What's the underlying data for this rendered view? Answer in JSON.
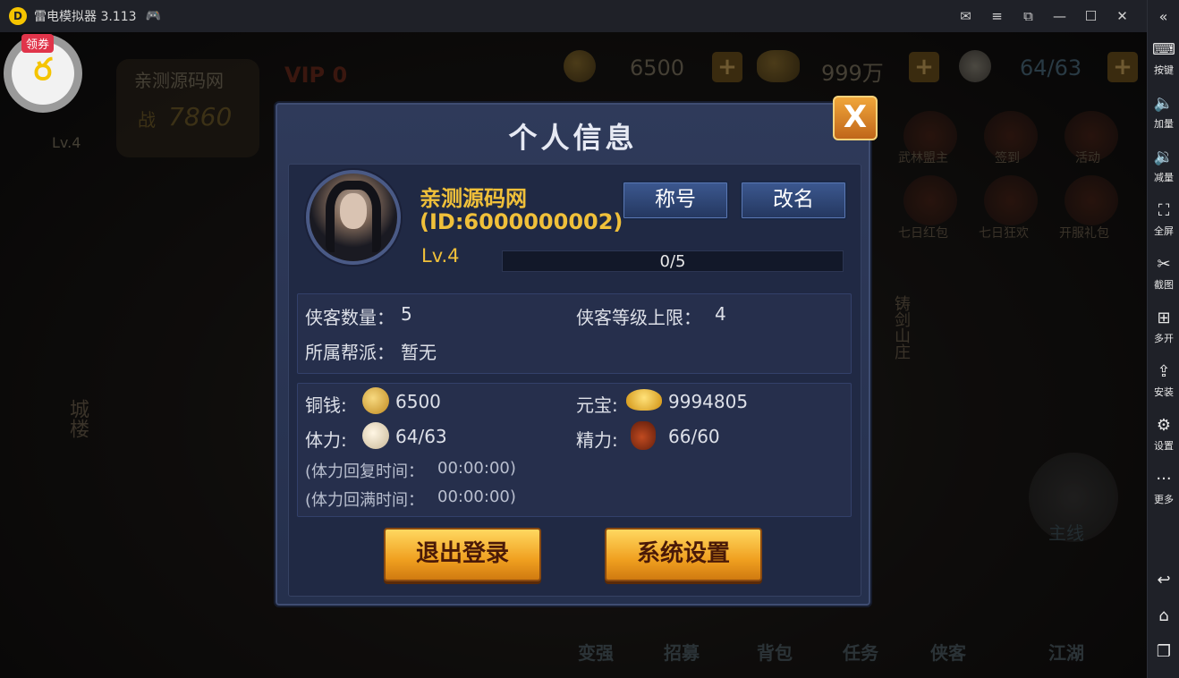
{
  "emulator": {
    "title": "雷电模拟器 3.113",
    "sidebar": [
      {
        "label": "按键",
        "icon": "keyboard-icon"
      },
      {
        "label": "加量",
        "icon": "volume-up-icon"
      },
      {
        "label": "减量",
        "icon": "volume-down-icon"
      },
      {
        "label": "全屏",
        "icon": "fullscreen-icon"
      },
      {
        "label": "截图",
        "icon": "scissors-icon"
      },
      {
        "label": "多开",
        "icon": "multi-instance-icon"
      },
      {
        "label": "安装",
        "icon": "apk-install-icon"
      },
      {
        "label": "设置",
        "icon": "gear-icon"
      },
      {
        "label": "更多",
        "icon": "more-icon"
      }
    ]
  },
  "float_widget": {
    "tag": "领券"
  },
  "hud": {
    "player_name": "亲测源码网",
    "vip": "VIP 0",
    "power_label": "战",
    "power": "7860",
    "level": "Lv.4",
    "copper": "6500",
    "ingot": "999万",
    "stamina": "64/63"
  },
  "background_menu": [
    "武林盟主",
    "签到",
    "活动",
    "七日红包",
    "七日狂欢",
    "开服礼包",
    "铸剑山庄",
    "城楼",
    "主线"
  ],
  "bottom_menu": [
    "变强",
    "招募",
    "背包",
    "任务",
    "侠客",
    "江湖"
  ],
  "dialog": {
    "title": "个人信息",
    "close_label": "X",
    "profile": {
      "name": "亲测源码网",
      "id": "(ID:6000000002)",
      "level": "Lv.4",
      "exp": "0/5",
      "exp_fraction": 0
    },
    "buttons": {
      "title_label": "称号",
      "rename_label": "改名"
    },
    "info": {
      "hero_count_label": "侠客数量：",
      "hero_count": "5",
      "hero_level_cap_label": "侠客等级上限：",
      "hero_level_cap": "4",
      "guild_label": "所属帮派：",
      "guild": "暂无"
    },
    "resources": {
      "copper_label": "铜钱:",
      "copper": "6500",
      "ingot_label": "元宝:",
      "ingot": "9994805",
      "stamina_label": "体力:",
      "stamina": "64/63",
      "energy_label": "精力:",
      "energy": "66/60",
      "stamina_recover_label": "(体力回复时间：",
      "stamina_recover": "00:00:00)",
      "stamina_full_label": "(体力回满时间：",
      "stamina_full": "00:00:00)"
    },
    "logout_label": "退出登录",
    "settings_label": "系统设置"
  }
}
